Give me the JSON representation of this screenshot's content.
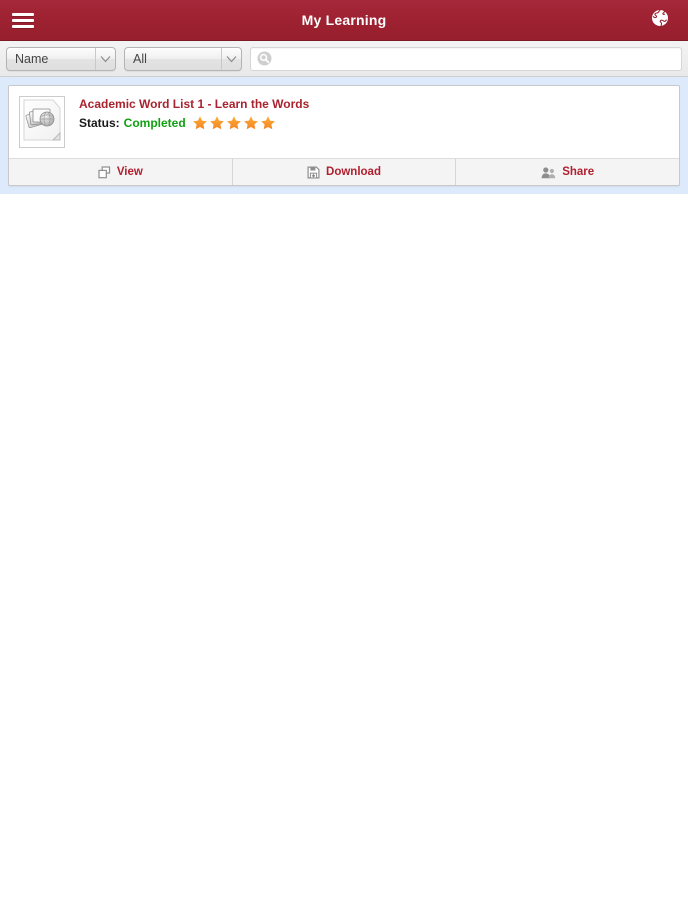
{
  "appbar": {
    "title": "My Learning",
    "menu_icon": "hamburger-menu-icon",
    "globe_icon": "globe-icon",
    "background_color": "#9d2130",
    "title_color": "#ffffff"
  },
  "filterbar": {
    "sort_select": {
      "value": "Name",
      "icon": "chevron-down-icon"
    },
    "filter_select": {
      "value": "All",
      "icon": "chevron-down-icon"
    },
    "search": {
      "value": "",
      "placeholder": "",
      "icon": "search-icon"
    }
  },
  "content": {
    "background_color": "#ddeafb",
    "items": [
      {
        "thumbnail_icon": "document-media-thumbnail-icon",
        "title": "Academic Word List 1 - Learn the Words",
        "title_color": "#a9232f",
        "status_label": "Status:",
        "status_value": "Completed",
        "status_color": "#12a012",
        "rating": 5,
        "rating_max": 5,
        "star_color": "#f79420",
        "actions": [
          {
            "label": "View",
            "icon": "window-restore-icon"
          },
          {
            "label": "Download",
            "icon": "save-download-icon"
          },
          {
            "label": "Share",
            "icon": "users-share-icon"
          }
        ]
      }
    ]
  }
}
